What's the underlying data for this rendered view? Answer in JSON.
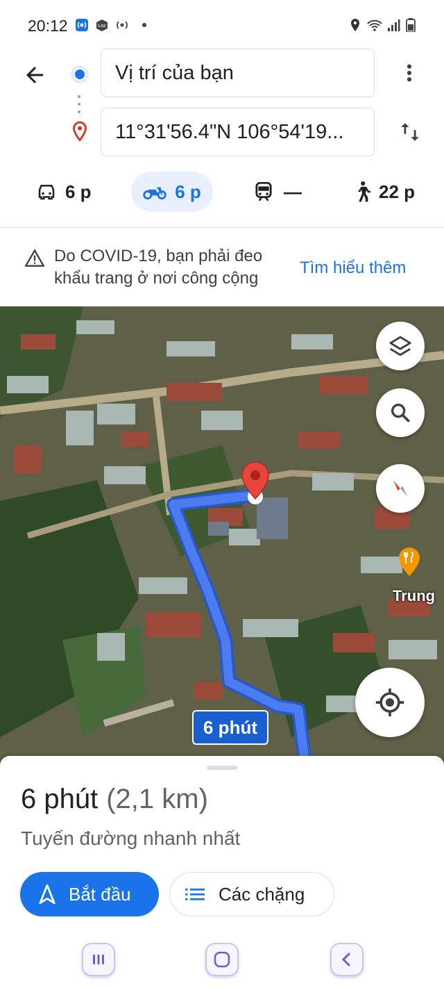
{
  "status_bar": {
    "time": "20:12",
    "left_icons": [
      "hotspot-icon",
      "lazada-icon",
      "hotspot-icon",
      "dot-icon"
    ],
    "right_icons": [
      "location-icon",
      "wifi-icon",
      "signal-icon",
      "battery-icon"
    ]
  },
  "directions": {
    "origin": "Vị trí của bạn",
    "destination": "11°31'56.4\"N 106°54'19...",
    "modes": [
      {
        "name": "car",
        "icon": "car-icon",
        "label": "6 p",
        "selected": false
      },
      {
        "name": "motorbike",
        "icon": "motorbike-icon",
        "label": "6 p",
        "selected": true
      },
      {
        "name": "transit",
        "icon": "train-icon",
        "label": "—",
        "selected": false
      },
      {
        "name": "walk",
        "icon": "walk-icon",
        "label": "22 p",
        "selected": false
      }
    ]
  },
  "notice": {
    "message": "Do COVID-19, bạn phải đeo khẩu trang ở nơi công cộng",
    "link": "Tìm hiểu thêm"
  },
  "map": {
    "route_label": "6 phút",
    "place_label": "Trung",
    "route_color": "#4b7df0",
    "pin_color": "#e8453c"
  },
  "sheet": {
    "duration": "6 phút",
    "distance": "(2,1 km)",
    "subtitle": "Tuyến đường nhanh nhất",
    "start_label": "Bắt đầu",
    "steps_label": "Các chặng"
  },
  "accent": "#1a73e8"
}
